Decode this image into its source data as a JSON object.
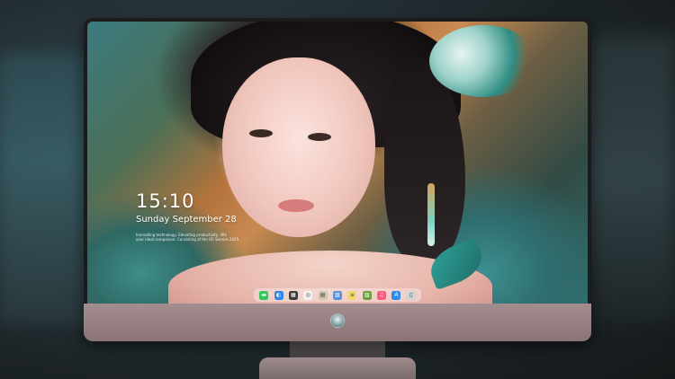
{
  "lock_screen": {
    "time": "15:10",
    "date": "Sunday September 28",
    "motto_line1": "Innovating technology, Elevating productivity, lifts",
    "motto_line2": "your ideal companion: Consisting of the OS Service 2025"
  },
  "dock": {
    "apps": [
      {
        "name": "Messages",
        "icon": "message-bubble-icon",
        "color": "#33c759",
        "glyph": "▬"
      },
      {
        "name": "Finder",
        "icon": "finder-icon",
        "color": "#2f87e8",
        "glyph": "◐"
      },
      {
        "name": "Launchpad",
        "icon": "launchpad-grid-icon",
        "color": "#3a3a3c",
        "glyph": "▦"
      },
      {
        "name": "Safari",
        "icon": "compass-icon",
        "color": "#f2f2f2",
        "glyph": "◎"
      },
      {
        "name": "Photos",
        "icon": "photo-frame-icon",
        "color": "#cfc6a8",
        "glyph": "▤"
      },
      {
        "name": "Clips",
        "icon": "clapperboard-icon",
        "color": "#5a8fe0",
        "glyph": "▧"
      },
      {
        "name": "Notes",
        "icon": "notes-icon",
        "color": "#f5d76e",
        "glyph": "≡"
      },
      {
        "name": "Preview",
        "icon": "preview-icon",
        "color": "#6d9f3e",
        "glyph": "▥"
      },
      {
        "name": "Music",
        "icon": "music-note-icon",
        "color": "#fa5c7c",
        "glyph": "♫"
      },
      {
        "name": "App Store",
        "icon": "app-store-icon",
        "color": "#2d8cf0",
        "glyph": "A"
      },
      {
        "name": "Trash",
        "icon": "trash-icon",
        "color": "#cfd3d6",
        "glyph": "▯"
      }
    ]
  },
  "colors": {
    "chin": "#a38d8e",
    "bezel": "#1b1b1d"
  }
}
